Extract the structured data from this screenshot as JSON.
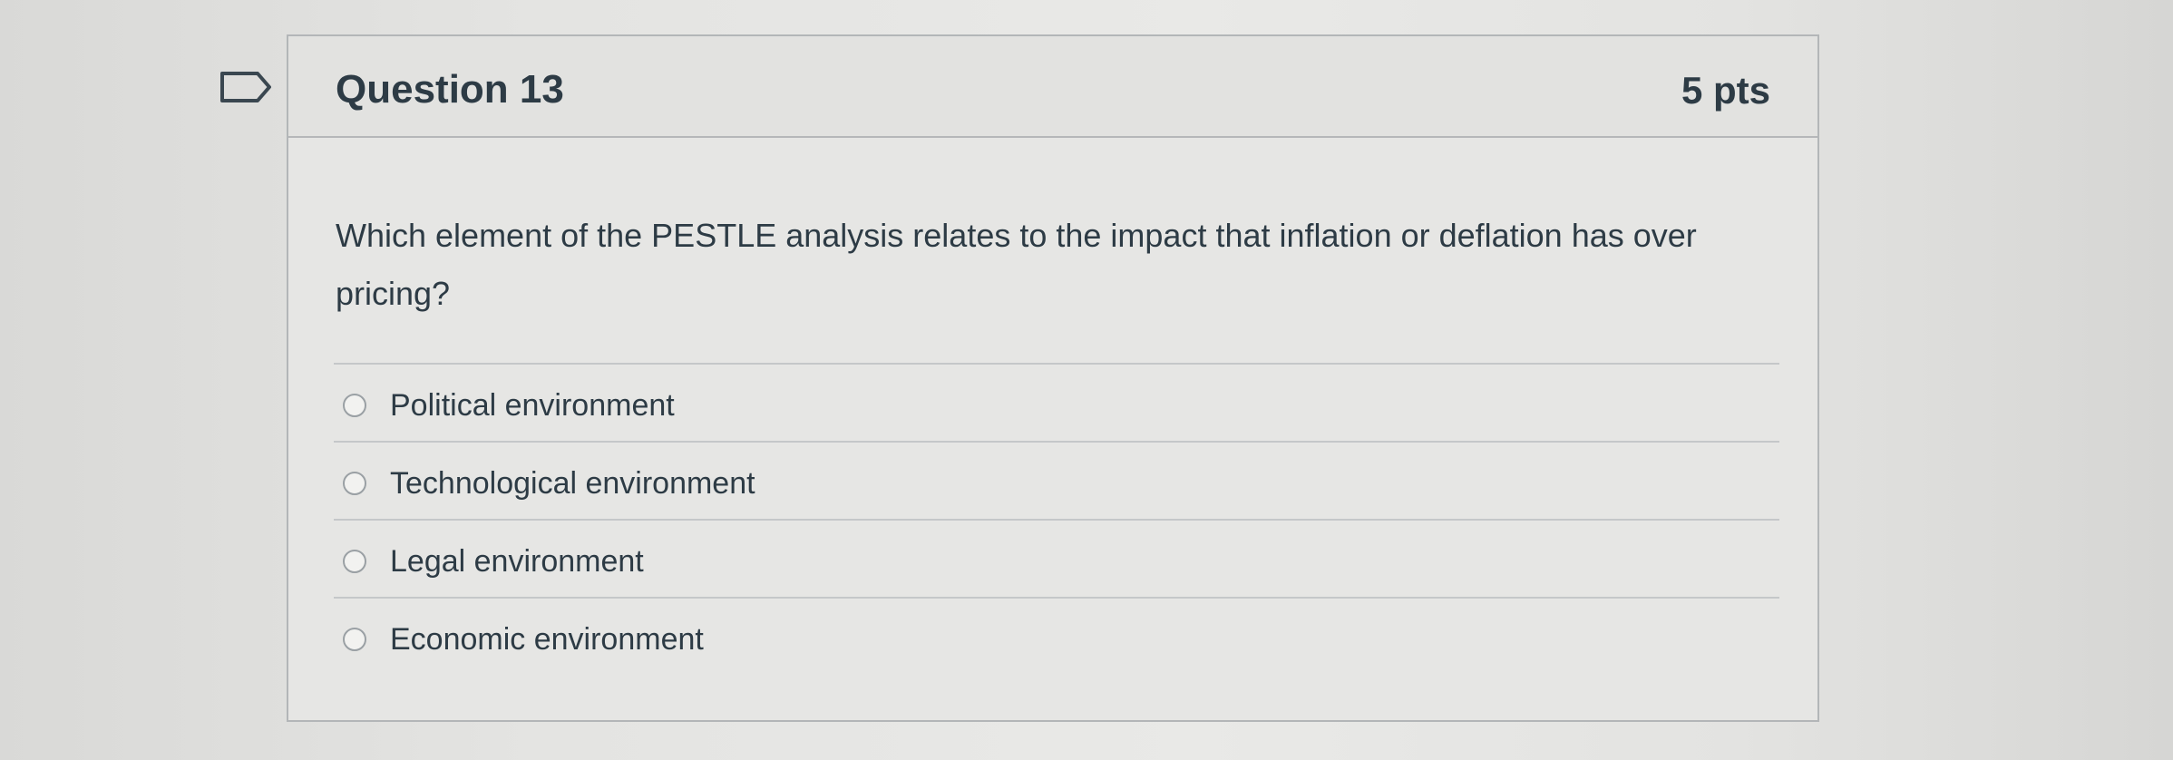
{
  "question": {
    "title": "Question 13",
    "points": "5 pts",
    "text": "Which element of the PESTLE analysis relates to the impact that inflation or deflation has over pricing?",
    "flag_icon": "flag-outline-icon",
    "answers": [
      {
        "label": "Political environment",
        "selected": false
      },
      {
        "label": "Technological environment",
        "selected": false
      },
      {
        "label": "Legal environment",
        "selected": false
      },
      {
        "label": "Economic environment",
        "selected": false
      }
    ]
  },
  "colors": {
    "text": "#2d3b45",
    "border": "#b3b6b8",
    "background": "#e6e6e4"
  }
}
